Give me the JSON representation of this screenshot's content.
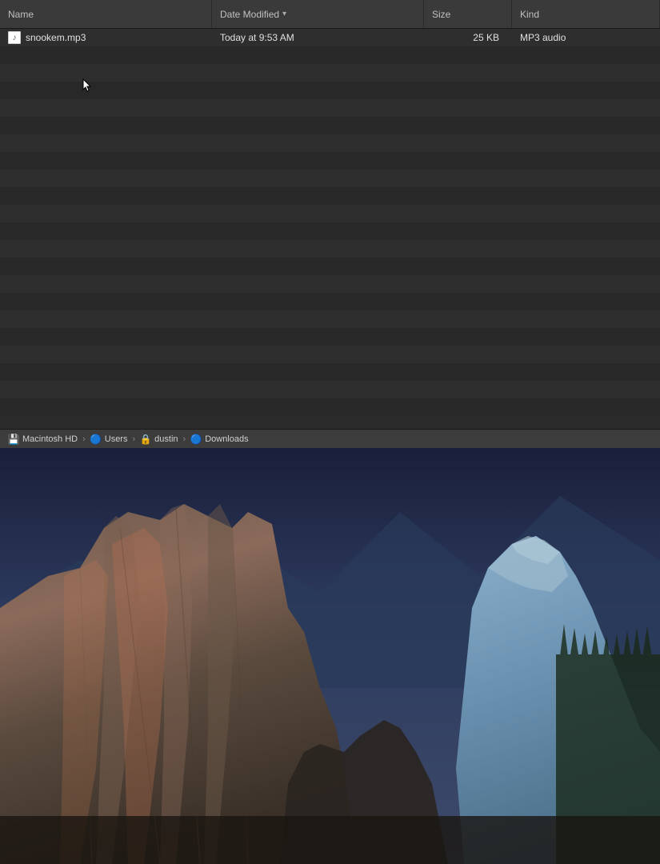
{
  "finder": {
    "headers": {
      "name": "Name",
      "date_modified": "Date Modified",
      "size": "Size",
      "kind": "Kind"
    },
    "file": {
      "name": "snookem.mp3",
      "date_modified": "Today at 9:53 AM",
      "size": "25 KB",
      "kind": "MP3 audio"
    },
    "sort_indicator": "▾",
    "row_count": 22
  },
  "breadcrumb": {
    "items": [
      {
        "label": "Macintosh HD",
        "icon": "💾"
      },
      {
        "label": "Users",
        "icon": "🔵"
      },
      {
        "label": "dustin",
        "icon": "🔒"
      },
      {
        "label": "Downloads",
        "icon": "🔵"
      }
    ],
    "separator": "›"
  }
}
